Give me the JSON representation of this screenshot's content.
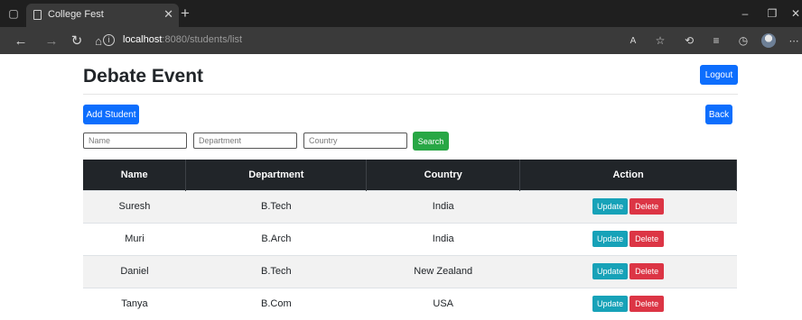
{
  "browser": {
    "tab_title": "College Fest",
    "url_host": "localhost",
    "url_rest": ":8080/students/list"
  },
  "page": {
    "title": "Debate Event",
    "logout_label": "Logout",
    "add_label": "Add Student",
    "back_label": "Back"
  },
  "search": {
    "name_placeholder": "Name",
    "department_placeholder": "Department",
    "country_placeholder": "Country",
    "button_label": "Search"
  },
  "table": {
    "headers": [
      "Name",
      "Department",
      "Country",
      "Action"
    ],
    "rows": [
      {
        "name": "Suresh",
        "department": "B.Tech",
        "country": "India"
      },
      {
        "name": "Muri",
        "department": "B.Arch",
        "country": "India"
      },
      {
        "name": "Daniel",
        "department": "B.Tech",
        "country": "New Zealand"
      },
      {
        "name": "Tanya",
        "department": "B.Com",
        "country": "USA"
      }
    ],
    "update_label": "Update",
    "delete_label": "Delete"
  },
  "colors": {
    "primary": "#0d6efd",
    "success": "#28a745",
    "info": "#17a2b8",
    "danger": "#dc3545",
    "table_header": "#212529"
  }
}
